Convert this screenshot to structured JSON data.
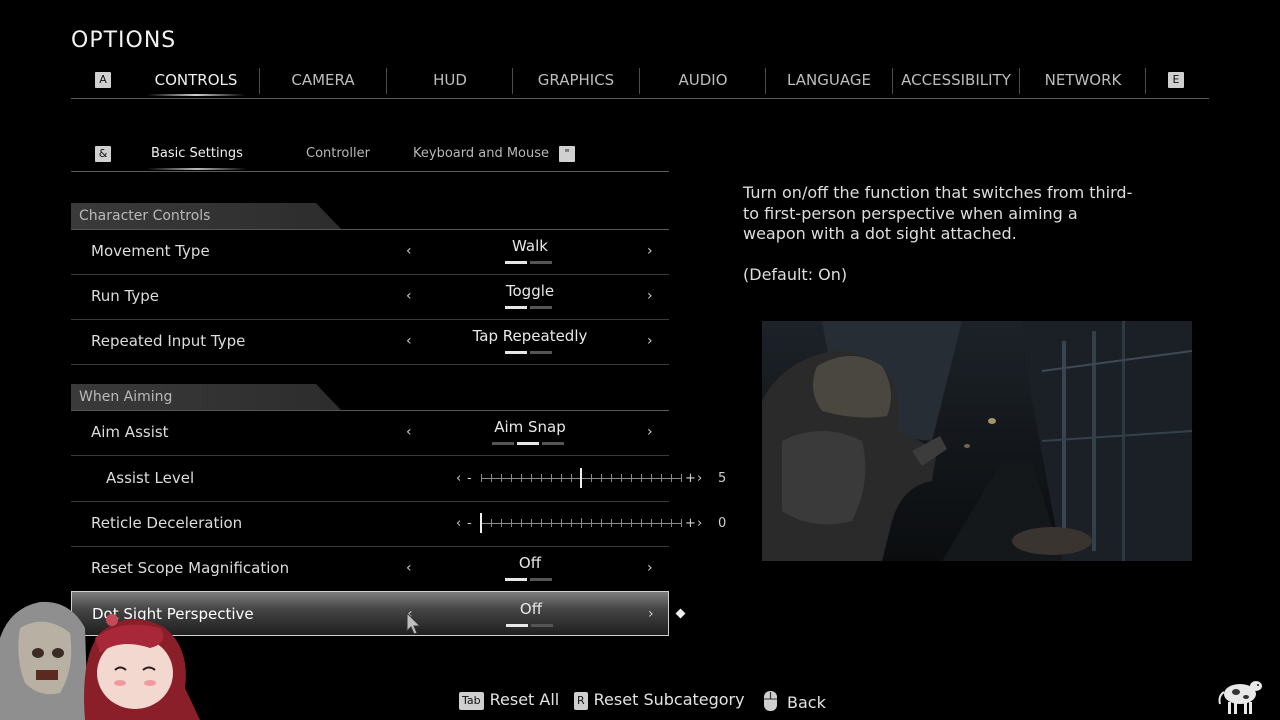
{
  "title": "OPTIONS",
  "top_tabs": {
    "left_key": "A",
    "right_key": "E",
    "items": [
      "CONTROLS",
      "CAMERA",
      "HUD",
      "GRAPHICS",
      "AUDIO",
      "LANGUAGE",
      "ACCESSIBILITY",
      "NETWORK"
    ],
    "active": "CONTROLS"
  },
  "sub_tabs": {
    "left_key": "&",
    "right_key": "\"",
    "items": [
      "Basic Settings",
      "Controller",
      "Keyboard and Mouse"
    ],
    "active": "Basic Settings"
  },
  "sections": {
    "character_controls": "Character Controls",
    "when_aiming": "When Aiming"
  },
  "arrows": {
    "left": "‹",
    "right": "›"
  },
  "slider_symbols": {
    "left_chevron": "‹",
    "minus": "-",
    "plus": "+",
    "right_chevron": "›"
  },
  "rows": {
    "movement_type": {
      "label": "Movement Type",
      "value": "Walk",
      "option_count": 2,
      "selected_index": 0
    },
    "run_type": {
      "label": "Run Type",
      "value": "Toggle",
      "option_count": 2,
      "selected_index": 0
    },
    "repeated_input_type": {
      "label": "Repeated Input Type",
      "value": "Tap Repeatedly",
      "option_count": 2,
      "selected_index": 0
    },
    "aim_assist": {
      "label": "Aim Assist",
      "value": "Aim Snap",
      "option_count": 3,
      "selected_index": 1
    },
    "assist_level": {
      "label": "Assist Level",
      "value": "5",
      "min": 0,
      "max": 10,
      "level": 5
    },
    "reticle_deceleration": {
      "label": "Reticle Deceleration",
      "value": "0",
      "min": 0,
      "max": 10,
      "level": 0
    },
    "reset_scope_magnification": {
      "label": "Reset Scope Magnification",
      "value": "Off",
      "option_count": 2,
      "selected_index": 0
    },
    "dot_sight_perspective": {
      "label": "Dot Sight Perspective",
      "value": "Off",
      "option_count": 2,
      "selected_index": 0
    }
  },
  "description": {
    "text": "Turn on/off the function that switches from third-to first-person perspective when aiming a weapon with a dot sight attached.",
    "default": "(Default: On)"
  },
  "footer": {
    "reset_all": {
      "key": "Tab",
      "label": "Reset All"
    },
    "reset_subcategory": {
      "key": "R",
      "label": "Reset Subcategory"
    },
    "back": {
      "label": "Back"
    }
  },
  "colors": {
    "background": "#000000",
    "text": "#dcdcdc",
    "selected_row": "#6e6e6e"
  }
}
